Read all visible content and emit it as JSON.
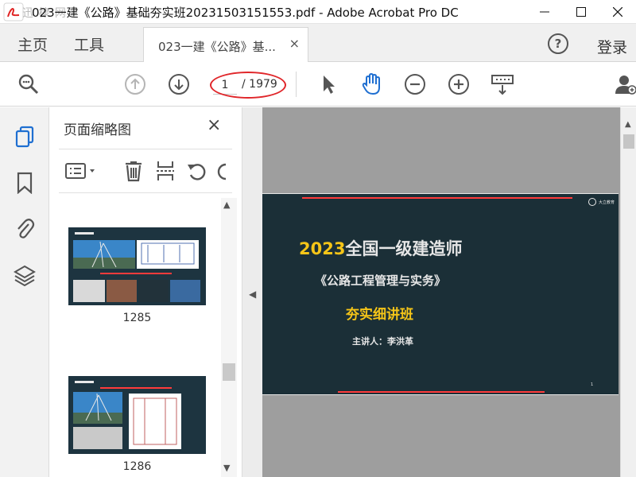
{
  "window": {
    "title": "023一建《公路》基础夯实班20231503151553.pdf - Adobe Acrobat Pro DC",
    "watermark": "迅 棣 网",
    "minimize_icon": "minimize-icon",
    "maximize_icon": "maximize-icon",
    "close_icon": "close-icon"
  },
  "tabs": {
    "home": "主页",
    "tools": "工具",
    "document": "023一建《公路》基...",
    "close_glyph": "×",
    "help_glyph": "?",
    "login": "登录"
  },
  "toolbar": {
    "page_current": "1",
    "page_total": "/ 1979",
    "icons": [
      "search-zoom-icon",
      "page-up-icon",
      "page-down-icon",
      "select-arrow-icon",
      "hand-tool-icon",
      "zoom-out-icon",
      "zoom-in-icon",
      "keyboard-icon",
      "share-user-icon"
    ]
  },
  "left_rail": {
    "icons": [
      "page-thumbnails-icon",
      "bookmark-icon",
      "attachment-icon",
      "layers-icon"
    ]
  },
  "thumbnail_panel": {
    "title": "页面缩略图",
    "close_glyph": "×",
    "tool_icons": [
      "options-menu-icon",
      "delete-icon",
      "insert-page-icon",
      "rotate-ccw-icon",
      "rotate-cw-icon"
    ],
    "pages": [
      {
        "label": "1285"
      },
      {
        "label": "1286"
      }
    ]
  },
  "slide": {
    "title_year": "2023",
    "title_rest": "全国一级建造师",
    "subtitle": "《公路工程管理与实务》",
    "class_name": "夯实细讲班",
    "teacher": "主讲人：李洪革",
    "logo_text": "大立教育",
    "page_number": "1"
  },
  "colors": {
    "slide_bg": "#1b2f37",
    "accent_yellow": "#f5c518",
    "annotation_red": "#e0262a",
    "viewport_bg": "#9e9e9e"
  }
}
